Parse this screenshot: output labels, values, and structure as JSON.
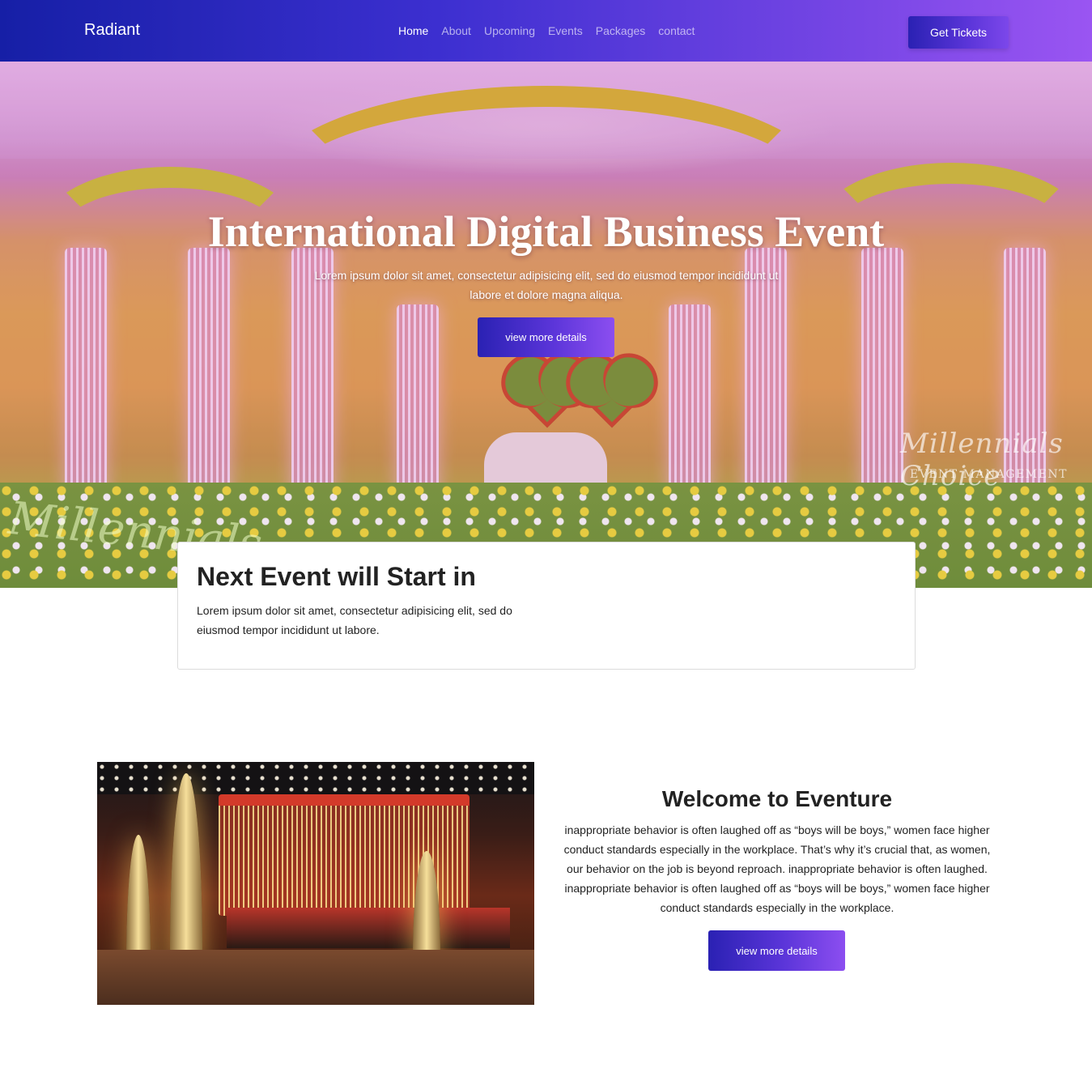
{
  "nav": {
    "brand": "Radiant",
    "links": [
      {
        "label": "Home",
        "active": true
      },
      {
        "label": "About",
        "active": false
      },
      {
        "label": "Upcoming",
        "active": false
      },
      {
        "label": "Events",
        "active": false
      },
      {
        "label": "Packages",
        "active": false
      },
      {
        "label": "contact",
        "active": false
      }
    ],
    "cta": "Get Tickets"
  },
  "hero": {
    "title": "International Digital Business Event",
    "subtitle": "Lorem ipsum dolor sit amet, consectetur adipisicing elit, sed do eiusmod tempor incididunt ut labore et dolore magna aliqua.",
    "button": "view more details",
    "watermark_line1": "Millennials Choice",
    "watermark_line2": "EVENT MANAGEMENT",
    "watermark_left": "Millennials"
  },
  "countdown": {
    "title": "Next Event will Start in",
    "text": "Lorem ipsum dolor sit amet, consectetur adipisicing elit, sed do eiusmod tempor incididunt ut labore."
  },
  "about": {
    "title": "Welcome to Eventure",
    "text": "inappropriate behavior is often laughed off as “boys will be boys,” women face higher conduct standards especially in the workplace. That’s why it’s crucial that, as women, our behavior on the job is beyond reproach. inappropriate behavior is often laughed. inappropriate behavior is often laughed off as “boys will be boys,” women face higher conduct standards especially in the workplace.",
    "button": "view more details"
  },
  "colors": {
    "gradient_start": "#161fa6",
    "gradient_end": "#9a55f2",
    "button_start": "#2a21b3",
    "button_end": "#8c4ef0"
  }
}
